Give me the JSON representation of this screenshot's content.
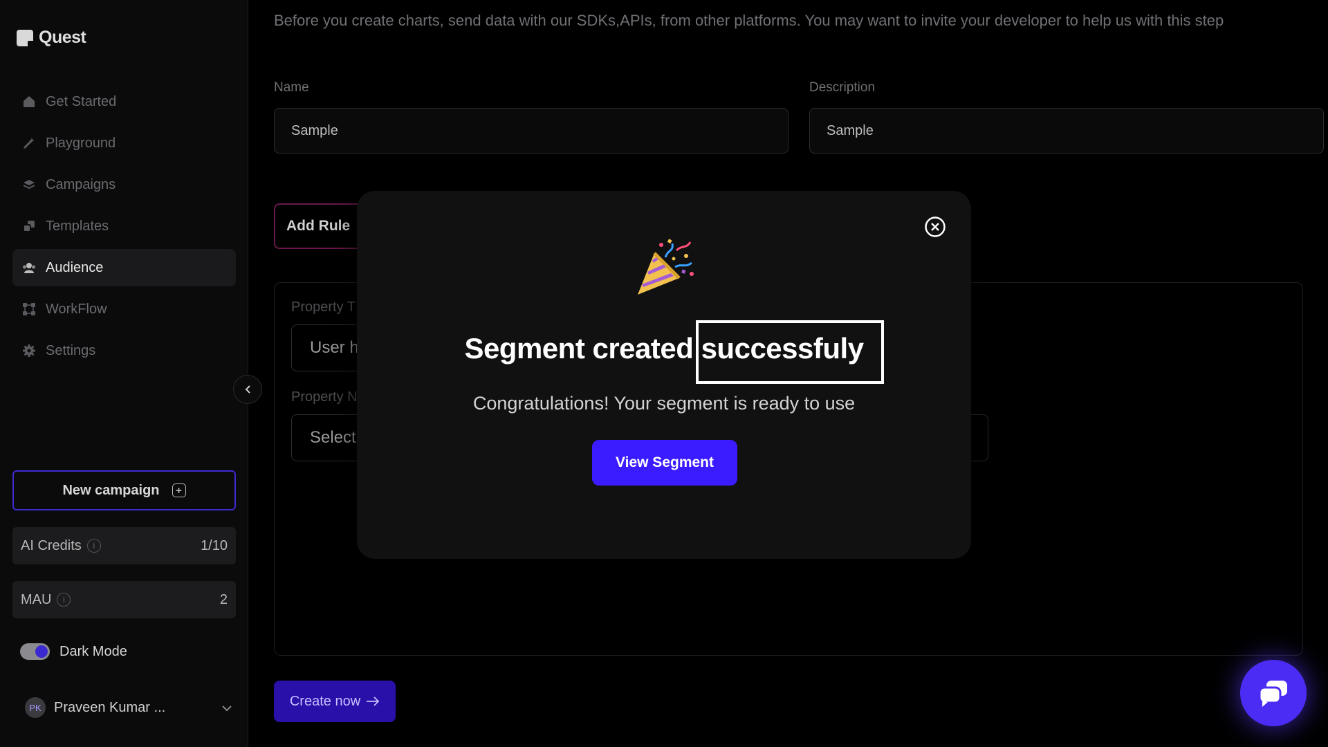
{
  "app": {
    "name": "Quest"
  },
  "sidebar": {
    "items": [
      {
        "label": "Get Started",
        "icon": "home-icon"
      },
      {
        "label": "Playground",
        "icon": "wand-icon"
      },
      {
        "label": "Campaigns",
        "icon": "layers-icon"
      },
      {
        "label": "Templates",
        "icon": "templates-icon"
      },
      {
        "label": "Audience",
        "icon": "users-icon",
        "active": true
      },
      {
        "label": "WorkFlow",
        "icon": "workflow-icon"
      },
      {
        "label": "Settings",
        "icon": "gear-icon"
      }
    ],
    "new_campaign": "New campaign",
    "ai_credits": {
      "label": "AI Credits",
      "value": "1/10"
    },
    "mau": {
      "label": "MAU",
      "value": "2"
    },
    "dark_mode": {
      "label": "Dark Mode",
      "enabled": true
    },
    "user": {
      "initials": "PK",
      "name": "Praveen Kumar ..."
    }
  },
  "main": {
    "intro": "Before you create charts, send data with our SDKs,APIs, from other platforms. You may want to invite your developer to help us with this step",
    "name_label": "Name",
    "name_value": "Sample",
    "description_label": "Description",
    "description_value": "Sample",
    "add_rule": "Add Rule",
    "property_type_label": "Property T",
    "property_type_value": "User h",
    "property_name_label": "Property N",
    "property_name_value": "Select",
    "create_now": "Create now"
  },
  "modal": {
    "title_part1": "Segment created",
    "title_part2": "successfuly",
    "subtitle": "Congratulations! Your segment is ready to use",
    "button": "View Segment"
  },
  "colors": {
    "accent": "#3b1bff",
    "background": "#000000",
    "sidebar_bg": "#0b0b0c",
    "modal_bg": "#111112"
  }
}
